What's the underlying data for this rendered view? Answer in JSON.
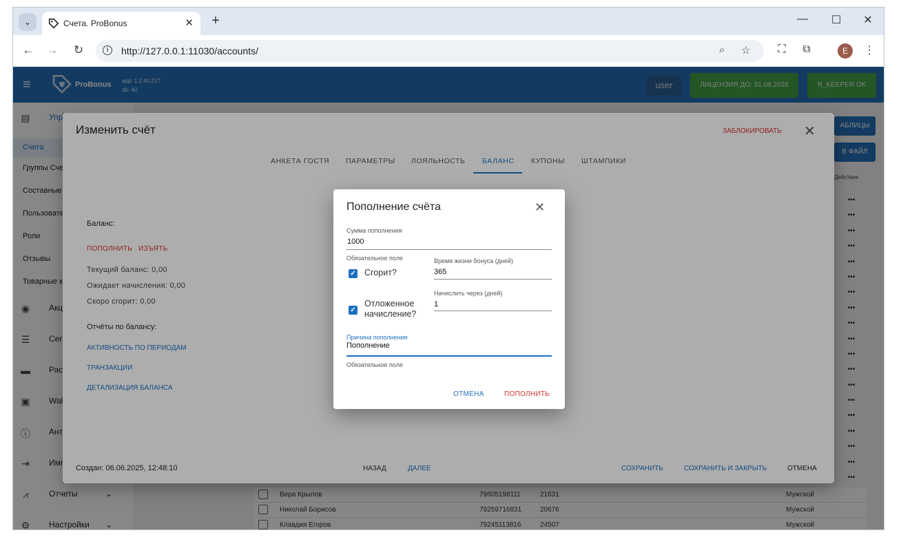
{
  "browser": {
    "tab_title": "Счета. ProBonus",
    "url": "http://127.0.0.1:11030/accounts/",
    "profile_initial": "E"
  },
  "app": {
    "logo_text": "ProBonus",
    "version_app": "app: 1.2.40.217",
    "version_db": "db: 40",
    "user": "user",
    "license": "ЛИЦЕНЗИЯ ДО: 31.08.2026",
    "rkeeper": "R_KEEPER OK",
    "brand_color": "#2470b8",
    "success_color": "#43a047"
  },
  "sidebar": {
    "sections": [
      {
        "label": "Упра",
        "icon": "clipboard-icon"
      },
      {
        "label": "Акц",
        "icon": "eye-icon"
      },
      {
        "label": "Сег",
        "icon": "filter-icon"
      },
      {
        "label": "Рас",
        "icon": "mail-icon"
      },
      {
        "label": "Wall",
        "icon": "wallet-icon"
      },
      {
        "label": "Анти",
        "icon": "alert-icon"
      },
      {
        "label": "Имп",
        "icon": "import-icon"
      },
      {
        "label": "Отчеты",
        "icon": "chart-icon"
      },
      {
        "label": "Настройки",
        "icon": "gear-icon"
      }
    ],
    "sub_items": [
      "Счета",
      "Группы Сче",
      "Составные",
      "Пользовате",
      "Роли",
      "Отзывы",
      "Товарные к"
    ]
  },
  "background": {
    "btn_tables": "АБЛИЦЫ",
    "btn_file": "В ФАЙЛ",
    "col_action": "Действие",
    "more": "•••",
    "rows": [
      {
        "name": "Вера Крылов",
        "phone": "79605198111",
        "card": "21631",
        "gender": "Мужской"
      },
      {
        "name": "Николай Борисов",
        "phone": "79259716831",
        "card": "20676",
        "gender": "Мужской"
      },
      {
        "name": "Клавдия Егоров",
        "phone": "79245113816",
        "card": "24507",
        "gender": "Мужской"
      }
    ]
  },
  "edit_dialog": {
    "title": "Изменить счёт",
    "block": "ЗАБЛОКИРОВАТЬ",
    "tabs": [
      "АНКЕТА ГОСТЯ",
      "ПАРАМЕТРЫ",
      "ЛОЯЛЬНОСТЬ",
      "БАЛАНС",
      "КУПОНЫ",
      "ШТАМПИКИ"
    ],
    "active_tab": "БАЛАНС",
    "balance_label": "Баланс:",
    "topup_link": "ПОПОЛНИТЬ",
    "withdraw_link": "ИЗЪЯТЬ",
    "current_balance": "Текущий баланс: 0,00",
    "pending": "Ожидает начисления: 0,00",
    "expiring": "Скоро сгорит: 0,00",
    "reports_label": "Отчёты по балансу:",
    "report_activity": "АКТИВНОСТЬ ПО ПЕРИОДАМ",
    "report_transactions": "ТРАНЗАКЦИИ",
    "report_details": "ДЕТАЛИЗАЦИЯ БАЛАНСА",
    "created": "Создан: 06.06.2025, 12:48:10",
    "back": "НАЗАД",
    "next": "ДАЛЕЕ",
    "save": "СОХРАНИТЬ",
    "save_close": "СОХРАНИТЬ И ЗАКРЫТЬ",
    "cancel": "ОТМЕНА"
  },
  "topup_dialog": {
    "title": "Пополнение счёта",
    "amount_label": "Сумма пополнения",
    "amount_value": "1000",
    "required": "Обязательное поле",
    "burns_label": "Сгорит?",
    "burns_checked": true,
    "lifetime_label": "Время жизни бонуса (дней)",
    "lifetime_value": "365",
    "deferred_label_1": "Отложенное",
    "deferred_label_2": "начисление?",
    "deferred_checked": true,
    "accrue_label": "Начислить через (дней)",
    "accrue_value": "1",
    "reason_label": "Причина пополнения",
    "reason_value": "Пополнение",
    "reason_required": "Обязательное поле",
    "cancel": "ОТМЕНА",
    "submit": "ПОПОЛНИТЬ",
    "accent": "#1f6fc0",
    "danger": "#d32f2f"
  }
}
